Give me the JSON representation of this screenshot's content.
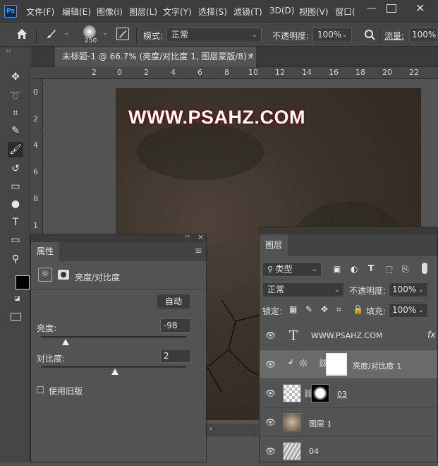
{
  "app": {
    "logo_text": "Ps"
  },
  "menu": [
    "文件(F)",
    "编辑(E)",
    "图像(I)",
    "图层(L)",
    "文字(Y)",
    "选择(S)",
    "滤镜(T)",
    "3D(D)",
    "视图(V)",
    "窗口("
  ],
  "window_controls": {
    "minimize": "—",
    "close": "✕"
  },
  "options_bar": {
    "home_icon": "home-icon",
    "brush_size": "250",
    "mode_label": "模式:",
    "mode_value": "正常",
    "opacity_label": "不透明度:",
    "opacity_value": "100%",
    "flow_label": "流量:",
    "flow_value": "100%"
  },
  "document": {
    "tab_title": "未标题-1 @ 66.7% (亮度/对比度 1, 图层蒙版/8) *",
    "close": "×",
    "ruler_h": [
      "2",
      "0",
      "2",
      "4",
      "6",
      "8",
      "10",
      "12",
      "14",
      "16",
      "18",
      "20",
      "22"
    ],
    "ruler_v": [
      "0",
      "2",
      "4",
      "6",
      "8",
      "1"
    ],
    "canvas_text": "WWW.PSAHZ.COM"
  },
  "properties": {
    "collapse": "‹‹",
    "close": "×",
    "tab": "属性",
    "menu_icon": "≡",
    "adjustment_title": "亮度/对比度",
    "auto_button": "自动",
    "brightness_label": "亮度:",
    "brightness_value": "-98",
    "brightness_fraction": 0.17,
    "contrast_label": "对比度:",
    "contrast_value": "2",
    "contrast_fraction": 0.51,
    "legacy_label": "使用旧版"
  },
  "layers_panel": {
    "tab": "图层",
    "filter_value": "类型",
    "blend_mode": "正常",
    "opacity_label": "不透明度:",
    "opacity_value": "100%",
    "lock_label": "锁定:",
    "fill_label": "填充:",
    "fill_value": "100%",
    "layers": [
      {
        "name": "WWW.PSAHZ.COM",
        "kind": "text",
        "fx": "fx"
      },
      {
        "name": "亮度/对比度 1",
        "kind": "adjustment",
        "selected": true
      },
      {
        "name": "03",
        "kind": "masked"
      },
      {
        "name": "图层 1",
        "kind": "pixel"
      },
      {
        "name": "04",
        "kind": "pixel"
      }
    ]
  },
  "colors": {
    "panel_bg": "#535353",
    "dark_bg": "#3c3c3c",
    "accent": "#31a8ff",
    "watermark_outline": "#6a0d0d"
  }
}
